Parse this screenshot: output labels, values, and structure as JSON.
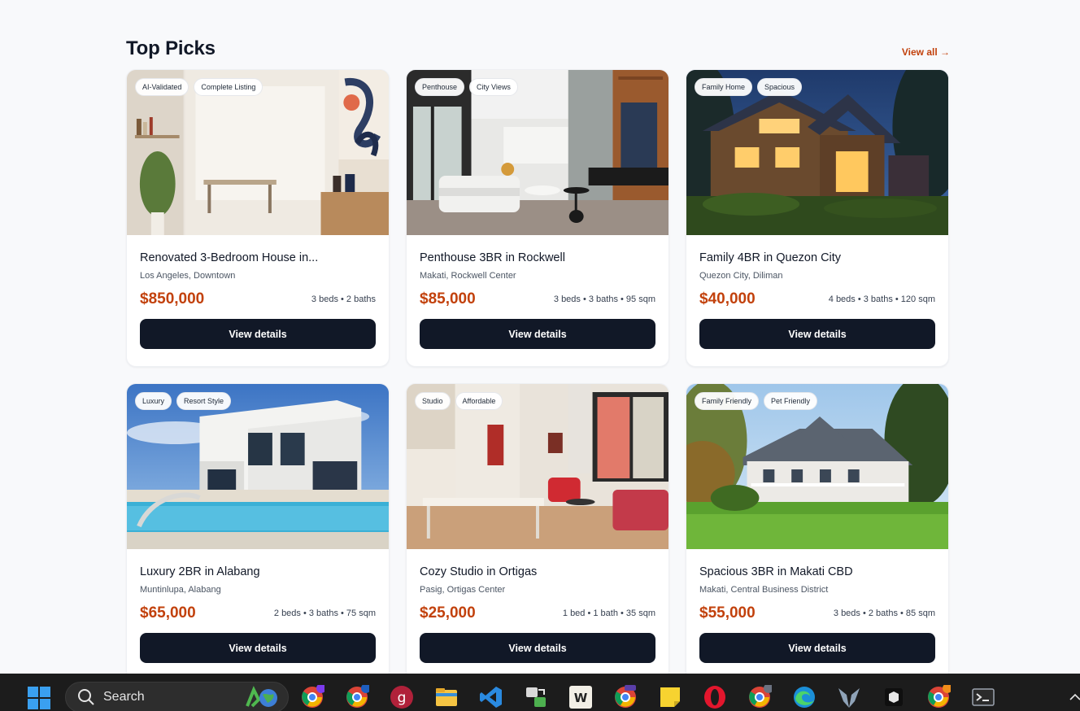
{
  "section": {
    "title": "Top Picks",
    "view_all": "View all →"
  },
  "listings": [
    {
      "tags": [
        "AI-Validated",
        "Complete Listing"
      ],
      "title": "Renovated 3-Bedroom House in...",
      "location": "Los Angeles, Downtown",
      "price": "$850,000",
      "specs": "3 beds • 2 baths",
      "button": "View details"
    },
    {
      "tags": [
        "Penthouse",
        "City Views"
      ],
      "title": "Penthouse 3BR in Rockwell",
      "location": "Makati, Rockwell Center",
      "price": "$85,000",
      "specs": "3 beds • 3 baths • 95 sqm",
      "button": "View details"
    },
    {
      "tags": [
        "Family Home",
        "Spacious"
      ],
      "title": "Family 4BR in Quezon City",
      "location": "Quezon City, Diliman",
      "price": "$40,000",
      "specs": "4 beds • 3 baths • 120 sqm",
      "button": "View details"
    },
    {
      "tags": [
        "Luxury",
        "Resort Style"
      ],
      "title": "Luxury 2BR in Alabang",
      "location": "Muntinlupa, Alabang",
      "price": "$65,000",
      "specs": "2 beds • 3 baths • 75 sqm",
      "button": "View details"
    },
    {
      "tags": [
        "Studio",
        "Affordable"
      ],
      "title": "Cozy Studio in Ortigas",
      "location": "Pasig, Ortigas Center",
      "price": "$25,000",
      "specs": "1 bed • 1 bath • 35 sqm",
      "button": "View details"
    },
    {
      "tags": [
        "Family Friendly",
        "Pet Friendly"
      ],
      "title": "Spacious 3BR in Makati CBD",
      "location": "Makati, Central Business District",
      "price": "$55,000",
      "specs": "3 beds • 2 baths • 85 sqm",
      "button": "View details"
    }
  ],
  "taskbar": {
    "search_label": "Search",
    "icons": [
      "windows-start-icon",
      "chrome-profile-k-icon",
      "chrome-profile-h-icon",
      "git-app-icon",
      "file-explorer-icon",
      "vscode-icon",
      "remote-transfer-icon",
      "writer-app-icon",
      "chrome-active-icon",
      "sticky-notes-icon",
      "opera-icon",
      "chrome-profile-h2-icon",
      "edge-icon",
      "predator-sense-icon",
      "box-app-icon",
      "chrome-profile-j-icon",
      "terminal-icon"
    ]
  }
}
